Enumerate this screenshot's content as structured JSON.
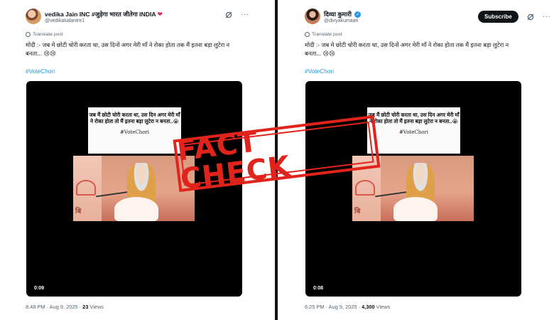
{
  "left_post": {
    "display_name": "vedika Jain INC #जुड़ेगा भारत जीतेगा INDIA",
    "handle": "@vedikakalantre1",
    "translate_label": "Translate post",
    "text": "मोदी :- जब मे छोटी चोरी करता था, उस दिनों अगर मेरी माँ ने रोका होता तक मैं इतना बड़ा लुटेरा न बनता... 😢😢",
    "hashtag": "#VoteChori",
    "video_caption": "जब मैं छोटी चोरी करता था, उस दिन अगर मेरी माँ ने रोका होता तो मैं इतना बड़ा लुटेरा न बनता..😭",
    "video_hashtag": "#VoteChori",
    "video_frame_text": "बि",
    "duration": "0:09",
    "time": "8:48 PM · Aug 9, 2025 · ",
    "views_count": "23",
    "views_label": " Views"
  },
  "right_post": {
    "display_name": "दिव्या कुमारी",
    "handle": "@divyakumaari",
    "subscribe_label": "Subscribe",
    "translate_label": "Translate post",
    "text": "मोदी :- जब मे छोटी चोरी करता था, उस दिनों अगर मेरी माँ ने रोका होता तक मैं इतना बड़ा लुटेरा न बनता... 😢😢",
    "hashtag": "#VoteChori",
    "video_caption": "जब मैं छोटी चोरी करता था, उस दिन अगर मेरी माँ ने रोका होता तो मैं इतना बड़ा लुटेरा न बनता..😭",
    "video_hashtag": "#VoteChori",
    "video_frame_text": "बि",
    "duration": "0:08",
    "time": "6:25 PM · Aug 9, 2025 · ",
    "views_count": "4,300",
    "views_label": " Views"
  },
  "stamp": {
    "text": "FACT CHECK",
    "color": "#e0241c"
  },
  "icons": {
    "heart": "heart-icon",
    "verified": "verified-badge-icon",
    "grok": "grok-icon",
    "more": "more-icon",
    "globe": "globe-icon"
  },
  "colors": {
    "link": "#1d9bf0",
    "muted": "#536471",
    "heart": "#e0245e"
  }
}
